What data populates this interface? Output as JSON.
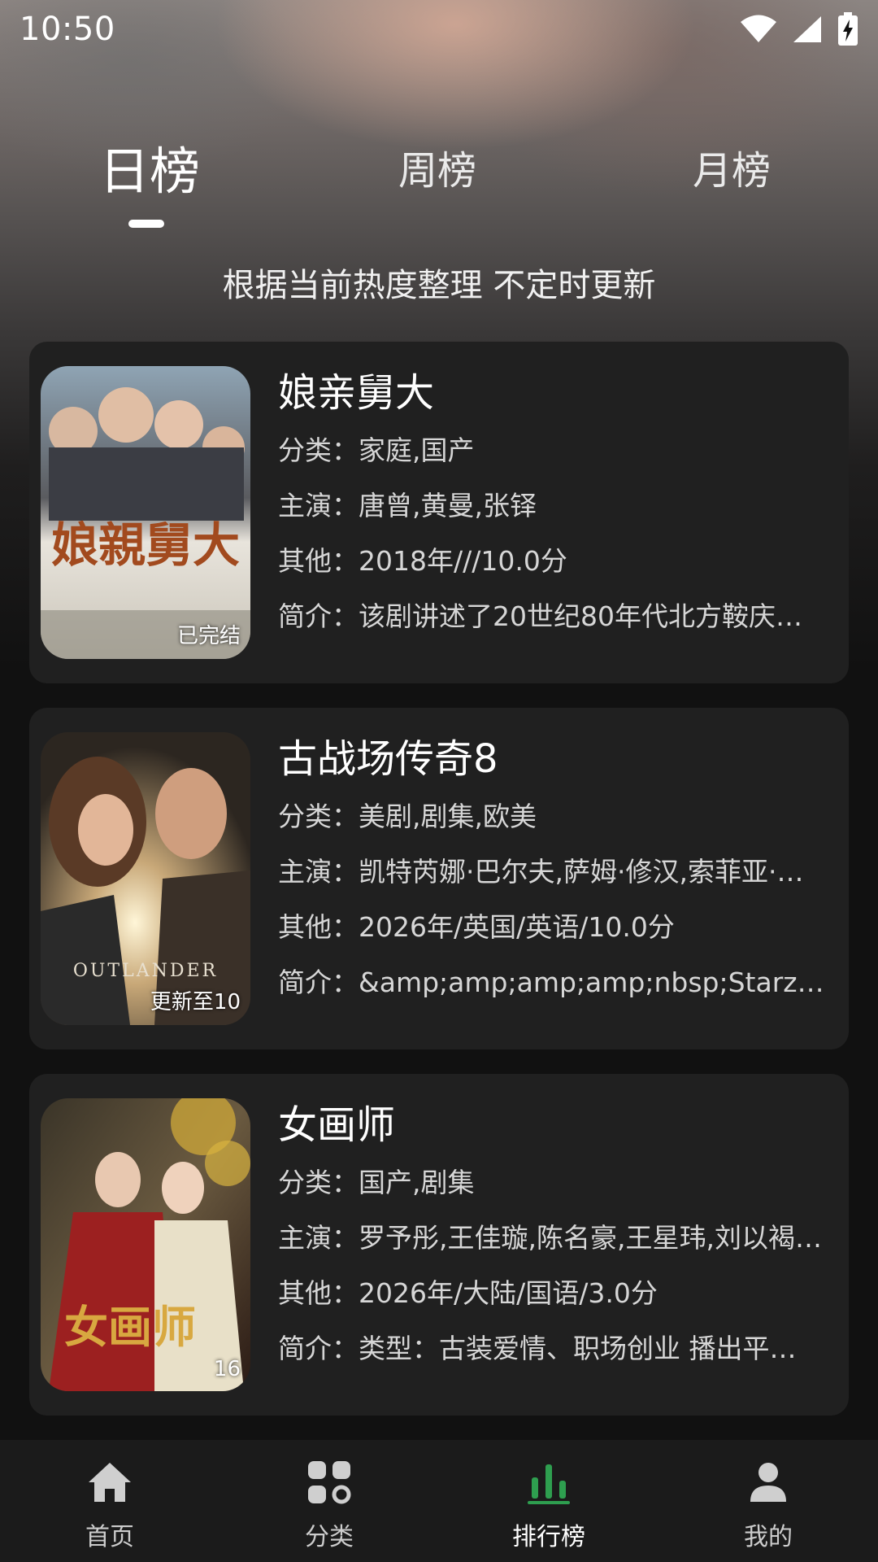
{
  "status_bar": {
    "time": "10:50"
  },
  "tabs": [
    {
      "label": "日榜",
      "active": true
    },
    {
      "label": "周榜",
      "active": false
    },
    {
      "label": "月榜",
      "active": false
    }
  ],
  "subtitle": "根据当前热度整理 不定时更新",
  "labels": {
    "category": "分类：",
    "cast": "主演：",
    "other": "其他：",
    "intro": "简介："
  },
  "items": [
    {
      "title": "娘亲舅大",
      "badge": "已完结",
      "category": "家庭,国产",
      "cast": "唐曾,黄曼,张铎",
      "other": "2018年///10.0分",
      "intro": "该剧讲述了20世纪80年代北方鞍庆…",
      "poster_text": "娘親舅大"
    },
    {
      "title": "古战场传奇8",
      "badge": "更新至10",
      "category": "美剧,剧集,欧美",
      "cast": "凯特芮娜·巴尔夫,萨姆·修汉,索菲亚·…",
      "other": "2026年/英国/英语/10.0分",
      "intro": "&amp;amp;amp;amp;nbsp;Starz宣…",
      "poster_text": "OUTLANDER"
    },
    {
      "title": "女画师",
      "badge": "16",
      "category": "国产,剧集",
      "cast": "罗予彤,王佳璇,陈名豪,王星玮,刘以褐…",
      "other": "2026年/大陆/国语/3.0分",
      "intro": "类型：古装爱情、职场创业 播出平…",
      "poster_text": "女画师"
    }
  ],
  "bottom_nav": [
    {
      "label": "首页",
      "icon": "home-icon",
      "active": false
    },
    {
      "label": "分类",
      "icon": "category-icon",
      "active": false
    },
    {
      "label": "排行榜",
      "icon": "ranking-icon",
      "active": true
    },
    {
      "label": "我的",
      "icon": "profile-icon",
      "active": false
    }
  ],
  "colors": {
    "accent": "#2e9e4f",
    "card_bg": "#202020",
    "nav_bg": "#1b1b1b"
  }
}
